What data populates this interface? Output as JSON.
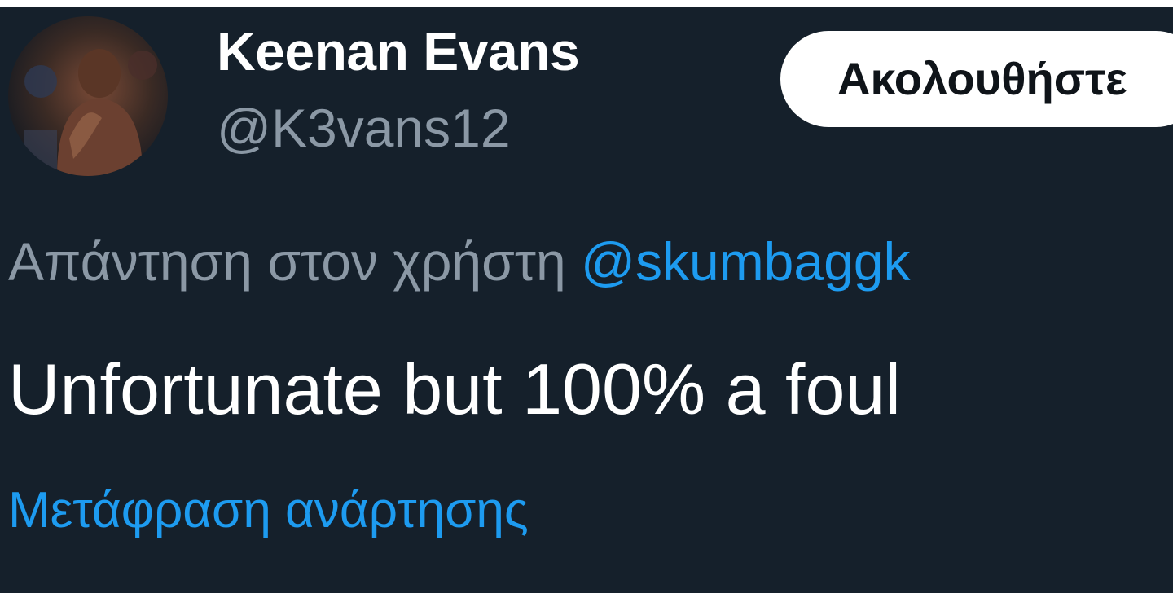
{
  "tweet": {
    "author_name": "Keenan Evans",
    "author_handle": "@K3vans12",
    "follow_label": "Ακολουθήστε",
    "reply_prefix": "Απάντηση στον χρήστη",
    "reply_to": "@skumbaggk",
    "text": "Unfortunate but 100% a foul",
    "translate_label": "Μετάφραση ανάρτησης"
  },
  "colors": {
    "background": "#15202b",
    "text_primary": "#ffffff",
    "text_secondary": "#8b98a5",
    "link": "#1d9bf0",
    "button_bg": "#ffffff",
    "button_text": "#0f1419"
  }
}
